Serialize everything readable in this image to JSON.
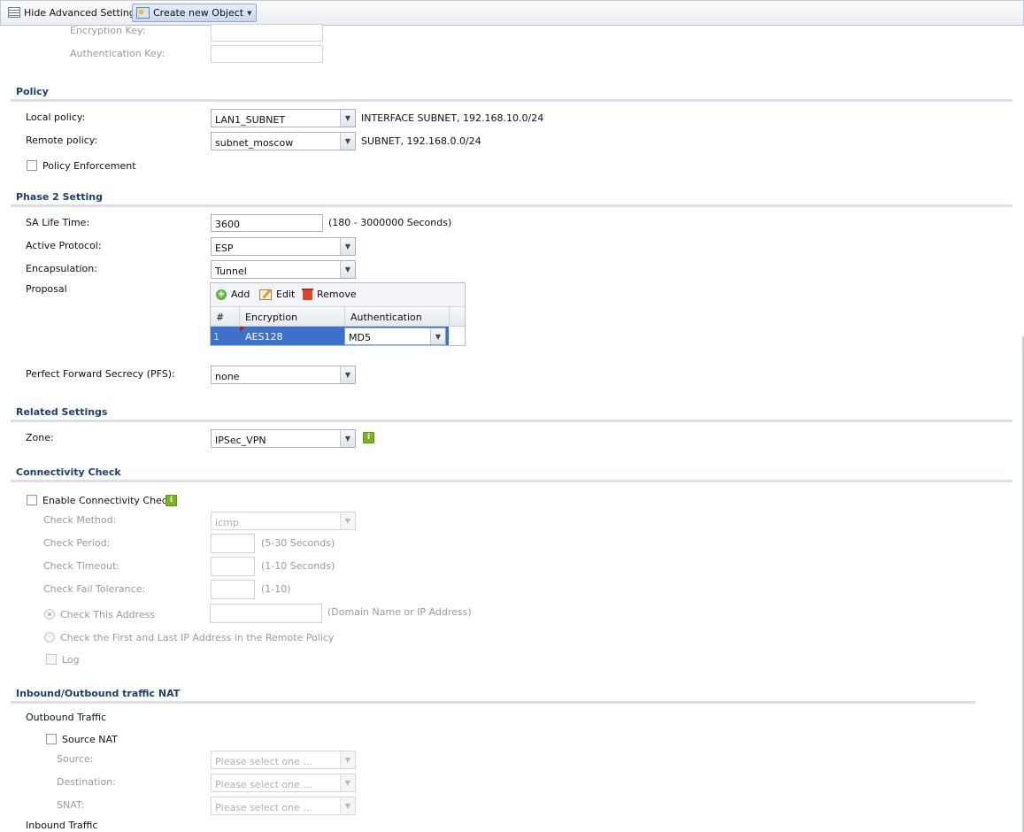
{
  "toolbar": {
    "hide_advanced": "Hide Advanced Settings",
    "create_object": "Create new Object"
  },
  "top_fields": {
    "encryption_key": "Encryption Key:",
    "authentication_key": "Authentication Key:"
  },
  "policy": {
    "title": "Policy",
    "local_label": "Local policy:",
    "local_value": "LAN1_SUBNET",
    "local_desc": "INTERFACE SUBNET, 192.168.10.0/24",
    "remote_label": "Remote policy:",
    "remote_value": "subnet_moscow",
    "remote_desc": "SUBNET, 192.168.0.0/24",
    "enforcement": "Policy Enforcement"
  },
  "phase2": {
    "title": "Phase 2 Setting",
    "sa_label": "SA Life Time:",
    "sa_value": "3600",
    "sa_hint": "(180 - 3000000 Seconds)",
    "protocol_label": "Active Protocol:",
    "protocol_value": "ESP",
    "encap_label": "Encapsulation:",
    "encap_value": "Tunnel",
    "proposal_label": "Proposal",
    "grid": {
      "add": "Add",
      "edit": "Edit",
      "remove": "Remove",
      "col_num": "#",
      "col_enc": "Encryption",
      "col_auth": "Authentication",
      "rows": [
        {
          "num": "1",
          "encryption": "AES128",
          "authentication": "MD5"
        }
      ]
    },
    "pfs_label": "Perfect Forward Secrecy (PFS):",
    "pfs_value": "none"
  },
  "related": {
    "title": "Related Settings",
    "zone_label": "Zone:",
    "zone_value": "IPSec_VPN"
  },
  "connectivity": {
    "title": "Connectivity Check",
    "enable": "Enable Connectivity Check",
    "method_label": "Check Method:",
    "method_value": "icmp",
    "period_label": "Check Period:",
    "period_hint": "(5-30 Seconds)",
    "timeout_label": "Check Timeout:",
    "timeout_hint": "(1-10 Seconds)",
    "fail_label": "Check Fail Tolerance:",
    "fail_hint": "(1-10)",
    "address_label": "Check This Address",
    "address_hint": "(Domain Name or IP Address)",
    "first_last_label": "Check the First and Last IP Address in the Remote Policy",
    "log_label": "Log"
  },
  "nat": {
    "title": "Inbound/Outbound traffic NAT",
    "outbound": "Outbound Traffic",
    "source_nat": "Source NAT",
    "source_label": "Source:",
    "destination_label": "Destination:",
    "snat_label": "SNAT:",
    "placeholder": "Please select one ...",
    "inbound": "Inbound Traffic"
  }
}
